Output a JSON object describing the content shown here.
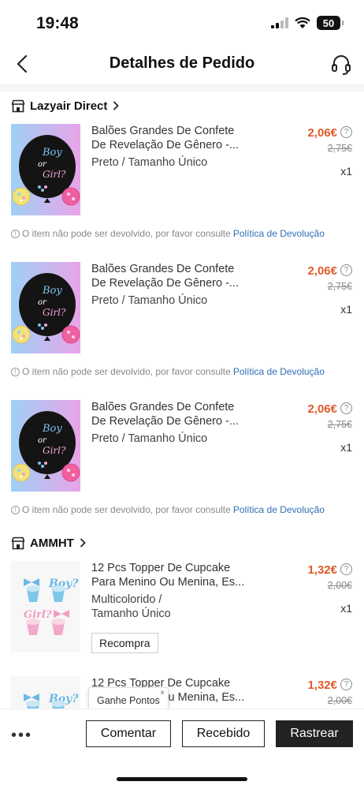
{
  "status_bar": {
    "time": "19:48",
    "battery": "50"
  },
  "header": {
    "title": "Detalhes de Pedido",
    "back_icon": "chevron-left-icon",
    "support_icon": "headset-icon"
  },
  "stores": [
    {
      "name": "Lazyair Direct",
      "icon": "store-icon"
    },
    {
      "name": "AMMHT",
      "icon": "store-icon"
    }
  ],
  "items": [
    {
      "name_line1": "Balões Grandes De Confete",
      "name_line2": "De Revelação De Gênero -...",
      "variant_line1": "Preto / Tamanho Único",
      "variant_line2": "",
      "price": "2,06€",
      "old_price": "2,75€",
      "qty": "x1"
    },
    {
      "name_line1": "Balões Grandes De Confete",
      "name_line2": "De Revelação De Gênero -...",
      "variant_line1": "Preto / Tamanho Único",
      "variant_line2": "",
      "price": "2,06€",
      "old_price": "2,75€",
      "qty": "x1"
    },
    {
      "name_line1": "Balões Grandes De Confete",
      "name_line2": "De Revelação De Gênero -...",
      "variant_line1": "Preto / Tamanho Único",
      "variant_line2": "",
      "price": "2,06€",
      "old_price": "2,75€",
      "qty": "x1"
    },
    {
      "name_line1": "12 Pcs Topper De Cupcake",
      "name_line2": "Para Menino Ou Menina, Es...",
      "variant_line1": "Multicolorido /",
      "variant_line2": "Tamanho Único",
      "price": "1,32€",
      "old_price": "2,00€",
      "qty": "x1",
      "rebuy_label": "Recompra"
    },
    {
      "name_line1": "12 Pcs Topper De Cupcake",
      "name_line2": "Para Menino Ou Menina, Es...",
      "variant_line1": "",
      "variant_line2": "",
      "price": "1,32€",
      "old_price": "2,00€",
      "qty": ""
    }
  ],
  "notice": {
    "text": "O item não pode ser devolvido, por favor consulte",
    "link": "Política de Devolução"
  },
  "balloon_text": {
    "boy": "Boy",
    "or": "or",
    "girl": "Girl?"
  },
  "topper_text": {
    "boy": "Boy?",
    "girl": "Girl?"
  },
  "tooltip": {
    "text": "Ganhe Pontos",
    "close": "×"
  },
  "footer": {
    "more": "•••",
    "comment": "Comentar",
    "received": "Recebido",
    "track": "Rastrear"
  },
  "colors": {
    "price": "#e05a2b",
    "link": "#2f6fb5",
    "dark_button": "#222222"
  }
}
